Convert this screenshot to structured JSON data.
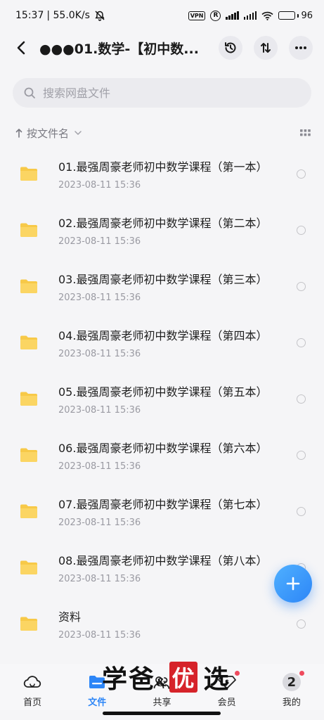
{
  "status_bar": {
    "time": "15:37",
    "speed": "| 55.0K/s",
    "vpn": "VPN",
    "r_badge": "R",
    "battery": "96"
  },
  "header": {
    "title": "●●●01.数学-【初中数..."
  },
  "search": {
    "placeholder": "搜索网盘文件"
  },
  "sort": {
    "label": "按文件名"
  },
  "files": [
    {
      "name": "01.最强周豪老师初中数学课程（第一本）",
      "date": "2023-08-11  15:36"
    },
    {
      "name": "02.最强周豪老师初中数学课程（第二本）",
      "date": "2023-08-11  15:36"
    },
    {
      "name": "03.最强周豪老师初中数学课程（第三本）",
      "date": "2023-08-11  15:36"
    },
    {
      "name": "04.最强周豪老师初中数学课程（第四本）",
      "date": "2023-08-11  15:36"
    },
    {
      "name": "05.最强周豪老师初中数学课程（第五本）",
      "date": "2023-08-11  15:36"
    },
    {
      "name": "06.最强周豪老师初中数学课程（第六本）",
      "date": "2023-08-11  15:36"
    },
    {
      "name": "07.最强周豪老师初中数学课程（第七本）",
      "date": "2023-08-11  15:36"
    },
    {
      "name": "08.最强周豪老师初中数学课程（第八本）",
      "date": "2023-08-11  15:36"
    },
    {
      "name": "资料",
      "date": "2023-08-11  15:36"
    }
  ],
  "bottom_nav": {
    "home": "首页",
    "files": "文件",
    "share": "共享",
    "vip": "会员",
    "mine": "我的",
    "avatar_text": "2"
  },
  "watermark": {
    "text1": "学爸",
    "amp": "&",
    "stamp": "优",
    "text2": "选"
  },
  "colors": {
    "accent": "#2d86f7",
    "folder": "#f7c948",
    "badge": "#ef4b5e"
  }
}
